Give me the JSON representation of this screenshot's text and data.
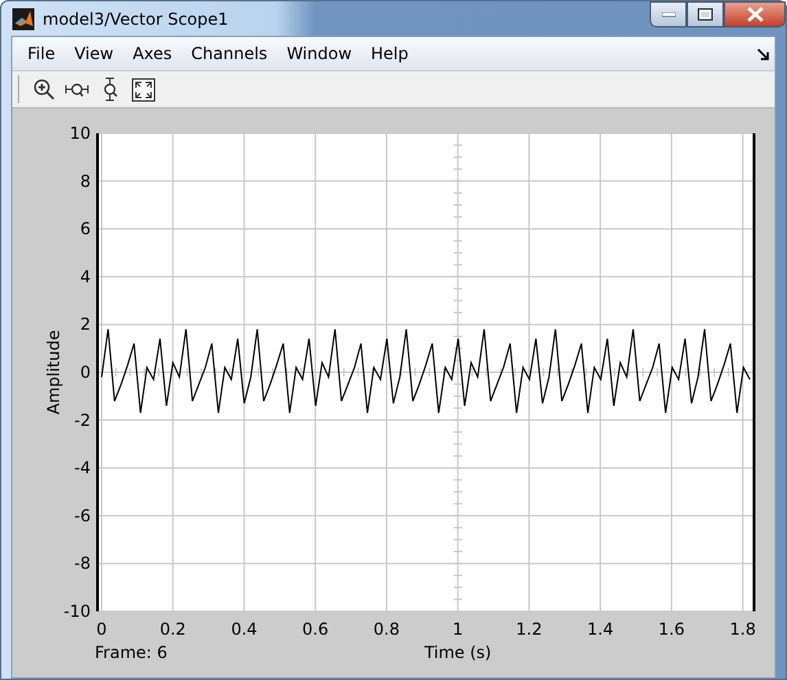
{
  "window": {
    "title": "model3/Vector Scope1"
  },
  "menu": [
    "File",
    "View",
    "Axes",
    "Channels",
    "Window",
    "Help"
  ],
  "axes": {
    "y_ticks": [
      "10",
      "8",
      "6",
      "4",
      "2",
      "0",
      "-2",
      "-4",
      "-6",
      "-8",
      "-10"
    ],
    "x_ticks": [
      "0",
      "0.2",
      "0.4",
      "0.6",
      "0.8",
      "1",
      "1.2",
      "1.4",
      "1.6",
      "1.8"
    ],
    "ylabel": "Amplitude",
    "xlabel": "Time (s)",
    "frame": "Frame: 6"
  }
}
